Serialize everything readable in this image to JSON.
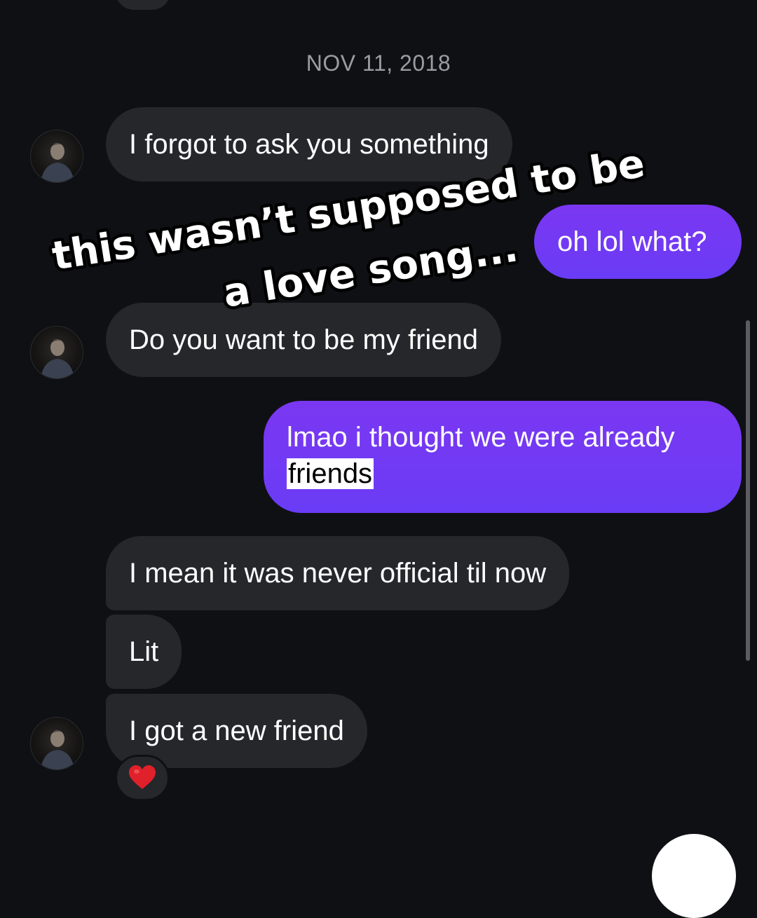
{
  "thread": {
    "date_divider": "NOV 11, 2018",
    "messages": [
      {
        "sender": "them",
        "text": "I forgot to ask you something"
      },
      {
        "sender": "me",
        "text": "oh lol what?"
      },
      {
        "sender": "them",
        "text": "Do you want to be my friend"
      },
      {
        "sender": "me",
        "line1": "lmao i thought we were already",
        "highlighted": "friends"
      },
      {
        "sender": "them",
        "text": "I mean it was never official til now"
      },
      {
        "sender": "them",
        "text": "Lit"
      },
      {
        "sender": "them",
        "text": "I got a new friend",
        "reaction": "heart"
      }
    ]
  },
  "overlay": {
    "line1": "this wasn’t supposed to be",
    "line2": "a love song..."
  },
  "colors": {
    "background": "#0f1014",
    "incoming_bubble": "#26272b",
    "outgoing_bubble": "#7337f4",
    "date_text": "#9a9ca3",
    "reaction_heart": "#e0202a"
  },
  "icons": {
    "avatar": "contact-avatar-photo",
    "reaction": "red-heart-icon"
  }
}
